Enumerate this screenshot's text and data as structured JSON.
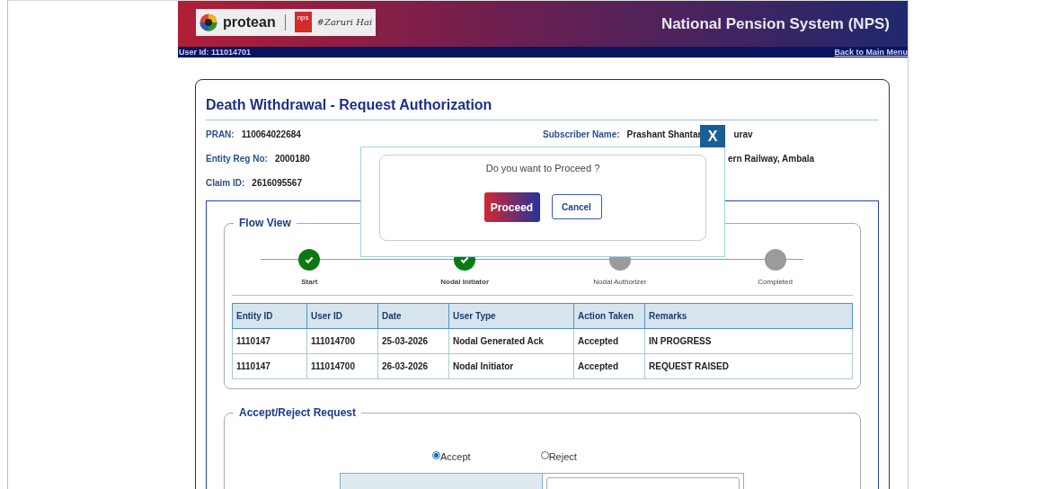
{
  "header": {
    "brand": "protean",
    "tagline": "#Zaruri Hai",
    "badge": "nps",
    "title": "National Pension System (NPS)"
  },
  "user_bar": {
    "user_id": "User Id: 111014701",
    "back_link": "Back to Main Menu"
  },
  "page": {
    "title": "Death Withdrawal - Request Authorization",
    "fields_left": [
      {
        "label": "PRAN:",
        "value": "110064022684"
      },
      {
        "label": "Entity Reg No:",
        "value": "2000180"
      },
      {
        "label": "Claim ID:",
        "value": "2616095567"
      }
    ],
    "fields_right": [
      {
        "label": "Subscriber Name:",
        "value": "Prashant Shantar",
        "value_tail": "urav"
      },
      {
        "value_tail": "ern Railway, Ambala"
      }
    ]
  },
  "flow_view": {
    "legend": "Flow View",
    "steps": [
      {
        "label": "Start",
        "done": true
      },
      {
        "label": "Nodal Initiator",
        "done": true
      },
      {
        "label": "Nodal Authorizer",
        "done": false
      },
      {
        "label": "Completed",
        "done": false
      }
    ],
    "table": {
      "columns": [
        "Entity ID",
        "User ID",
        "Date",
        "User Type",
        "Action Taken",
        "Remarks"
      ],
      "rows": [
        [
          "1110147",
          "111014700",
          "25-03-2026",
          "Nodal Generated Ack",
          "Accepted",
          "IN PROGRESS"
        ],
        [
          "1110147",
          "111014700",
          "26-03-2026",
          "Nodal Initiator",
          "Accepted",
          "REQUEST RAISED"
        ]
      ]
    }
  },
  "accept_reject": {
    "legend": "Accept/Reject Request",
    "options": [
      {
        "label": "Accept",
        "selected": true
      },
      {
        "label": "Reject",
        "selected": false
      }
    ]
  },
  "dialog": {
    "close": "X",
    "message": "Do you want to Proceed ?",
    "buttons": [
      {
        "label": "Proceed",
        "kind": "primary"
      },
      {
        "label": "Cancel",
        "kind": "secondary"
      }
    ]
  }
}
